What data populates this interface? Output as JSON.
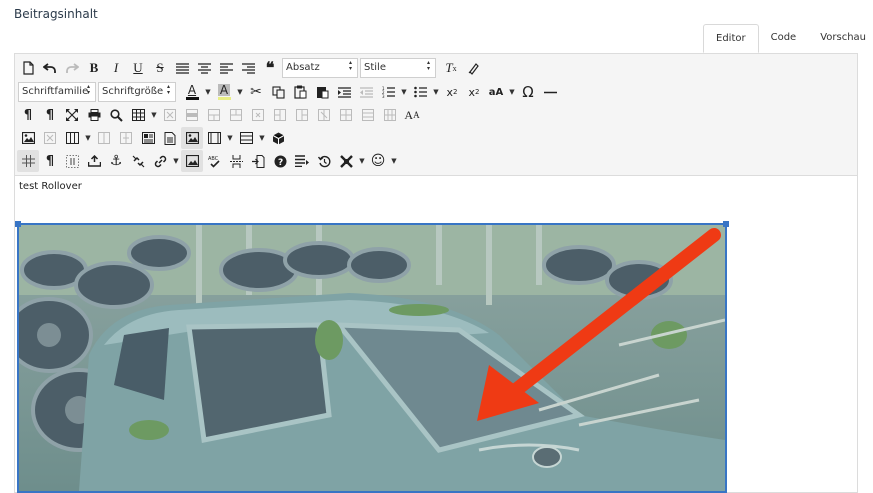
{
  "section_title": "Beitragsinhalt",
  "tabs": [
    {
      "label": "Editor",
      "active": true
    },
    {
      "label": "Code",
      "active": false
    },
    {
      "label": "Vorschau",
      "active": false
    }
  ],
  "toolbar": {
    "format_select": "Absatz",
    "styles_select": "Stile",
    "font_family_select": "Schriftfamilie",
    "font_size_select": "Schriftgröße",
    "text_color_letter": "A",
    "bg_color_letter": "A"
  },
  "content": {
    "paragraph": "test Rollover"
  },
  "colors": {
    "selection": "#3875c5",
    "arrow": "#ef3a14",
    "highlight": "#e9ef86"
  }
}
